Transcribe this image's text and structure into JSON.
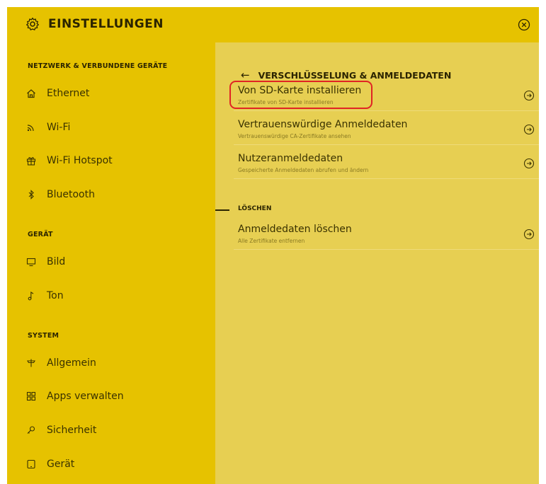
{
  "colors": {
    "accent": "#e6c200",
    "panel": "#e7cf52",
    "text": "#2b2400",
    "subtext": "#8a7a22",
    "highlight": "#e02424"
  },
  "header": {
    "title": "EINSTELLUNGEN",
    "gear_icon": "gear-icon",
    "close_icon": "close-circle-icon"
  },
  "sidebar": {
    "sections": [
      {
        "title": "NETZWERK & VERBUNDENE GERÄTE"
      },
      {
        "title": "GERÄT"
      },
      {
        "title": "SYSTEM"
      }
    ],
    "items": [
      {
        "label": "Ethernet",
        "icon": "home-icon"
      },
      {
        "label": "Wi-Fi",
        "icon": "wifi-icon"
      },
      {
        "label": "Wi-Fi Hotspot",
        "icon": "gift-icon"
      },
      {
        "label": "Bluetooth",
        "icon": "bluetooth-icon"
      },
      {
        "label": "Bild",
        "icon": "monitor-icon"
      },
      {
        "label": "Ton",
        "icon": "music-note-icon"
      },
      {
        "label": "Allgemein",
        "icon": "signpost-icon"
      },
      {
        "label": "Apps verwalten",
        "icon": "apps-grid-icon"
      },
      {
        "label": "Sicherheit",
        "icon": "key-icon"
      },
      {
        "label": "Gerät",
        "icon": "device-icon"
      }
    ]
  },
  "main": {
    "back_arrow": "←",
    "title": "VERSCHLÜSSELUNG & ANMELDEDATEN",
    "rows": [
      {
        "title": "Von SD-Karte installieren",
        "subtitle": "Zertifikate von SD-Karte installieren"
      },
      {
        "title": "Vertrauenswürdige Anmeldedaten",
        "subtitle": "Vertrauenswürdige CA-Zertifikate ansehen"
      },
      {
        "title": "Nutzeranmeldedaten",
        "subtitle": "Gespeicherte Anmeldedaten abrufen und ändern"
      }
    ],
    "delete_section": {
      "title": "LÖSCHEN",
      "rows": [
        {
          "title": "Anmeldedaten löschen",
          "subtitle": "Alle Zertifikate entfernen"
        }
      ]
    }
  }
}
